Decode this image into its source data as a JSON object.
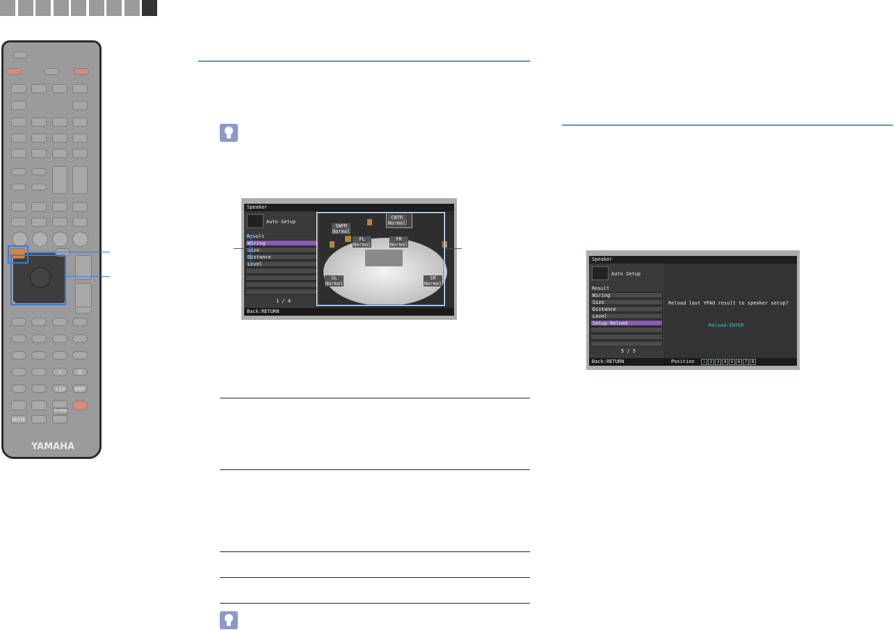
{
  "nav_tabs": {
    "count": 9,
    "active_index": 8
  },
  "remote": {
    "brand": "YAMAHA",
    "buttons": {
      "ent": "ENT",
      "plus10": "+10",
      "num7": "7",
      "num8": "8",
      "mute": "MUTE",
      "tv": "TV VOL"
    },
    "highlight_color": "#3a7bd5",
    "accent_color": "#e57d32"
  },
  "screen1": {
    "title": "Speaker",
    "heading": "Auto Setup",
    "section": "Result",
    "menu": [
      "Wiring",
      "Size",
      "Distance",
      "Level",
      "",
      "",
      "",
      ""
    ],
    "selected": 0,
    "page": "1 / 4",
    "footer": "Back:RETURN",
    "speakers": {
      "cntr": [
        "CNTR",
        "Normal"
      ],
      "swfr": [
        "SWFR",
        "Normal"
      ],
      "fl": [
        "FL",
        "Normal"
      ],
      "fr": [
        "FR",
        "Normal"
      ],
      "sl": [
        "SL",
        "Normal"
      ],
      "sr": [
        "SR",
        "Normal"
      ]
    }
  },
  "screen2": {
    "title": "Speaker",
    "heading": "Auto Setup",
    "section": "Result",
    "menu": [
      "Wiring",
      "Size",
      "Distance",
      "Level",
      "Setup Reload",
      "",
      "",
      ""
    ],
    "selected": 4,
    "page": "5 / 5",
    "message": "Reload last YPAO result to speaker setup?",
    "action": "Reload:ENTER",
    "footer": "Back:RETURN",
    "position_label": "Position",
    "positions": [
      "1",
      "2",
      "3",
      "4",
      "5",
      "6",
      "7",
      "8"
    ],
    "active_position": "1",
    "action_color": "#3cc6c6"
  }
}
